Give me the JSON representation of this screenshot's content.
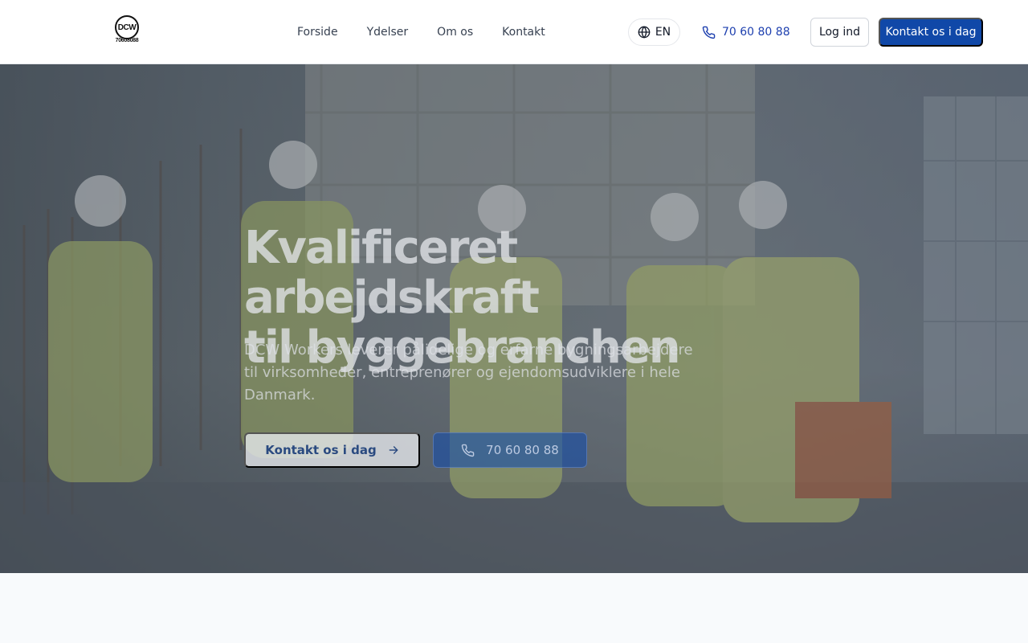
{
  "header": {
    "logo": {
      "mark": "DCW",
      "phone": "70608088"
    },
    "nav": [
      {
        "label": "Forside"
      },
      {
        "label": "Ydelser"
      },
      {
        "label": "Om os"
      },
      {
        "label": "Kontakt"
      }
    ],
    "language": {
      "label": "EN",
      "icon": "globe-icon"
    },
    "phone": {
      "label": "70 60 80 88",
      "icon": "phone-icon"
    },
    "login_label": "Log ind",
    "cta_label": "Kontakt os i dag"
  },
  "hero": {
    "title_line1": "Kvalificeret arbejdskraft",
    "title_line2": "til byggebranchen",
    "subtitle": "DCW Workers leverer pålidelige og erfarne bygningsarbejdere til virksomheder, entreprenører og ejendomsudviklere i hele Danmark.",
    "cta_label": "Kontakt os i dag",
    "cta_icon": "arrow-right-icon",
    "phone_label": "70 60 80 88",
    "phone_icon": "phone-icon"
  },
  "colors": {
    "brand": "#1048a8",
    "link": "#1e40af",
    "background": "#f8fafc"
  }
}
